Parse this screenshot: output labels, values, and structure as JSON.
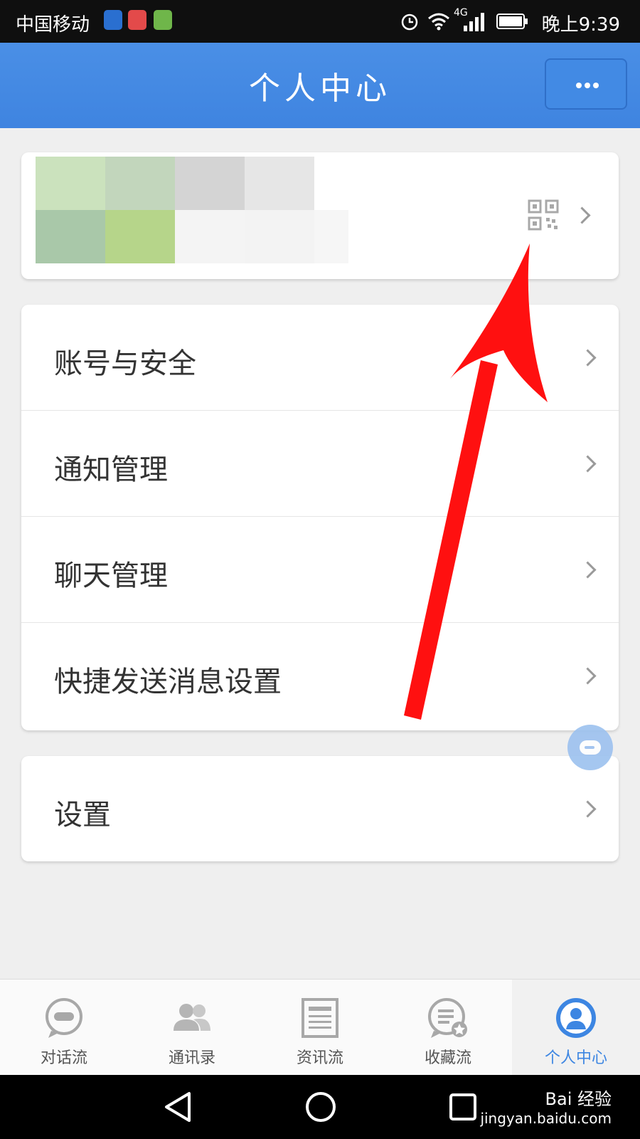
{
  "status_bar": {
    "carrier": "中国移动",
    "network": "4G",
    "time": "晚上9:39"
  },
  "header": {
    "title": "个人中心",
    "more_icon": "more-dots-icon"
  },
  "profile": {
    "qr_icon": "qr-code-icon"
  },
  "menu": {
    "items": [
      {
        "label": "账号与安全"
      },
      {
        "label": "通知管理"
      },
      {
        "label": "聊天管理"
      },
      {
        "label": "快捷发送消息设置"
      }
    ]
  },
  "settings": {
    "label": "设置"
  },
  "tabbar": {
    "tabs": [
      {
        "label": "对话流",
        "icon": "chat-icon"
      },
      {
        "label": "通讯录",
        "icon": "contacts-icon"
      },
      {
        "label": "资讯流",
        "icon": "news-icon"
      },
      {
        "label": "收藏流",
        "icon": "favorites-icon"
      },
      {
        "label": "个人中心",
        "icon": "profile-icon",
        "active": true
      }
    ]
  },
  "watermark": {
    "brand": "Bai 经验",
    "url": "jingyan.baidu.com"
  },
  "colors": {
    "header": "#4a8fe6",
    "accent": "#3d86e2",
    "arrow": "#ff1010"
  }
}
